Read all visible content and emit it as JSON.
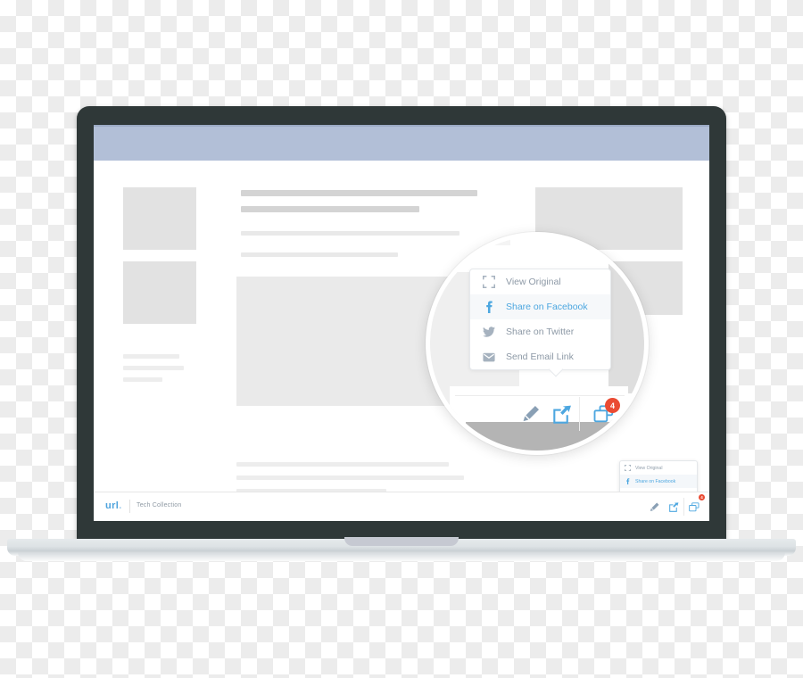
{
  "scene": {
    "device": "laptop",
    "background": "transparency-checkerboard"
  },
  "colors": {
    "bezel": "#2f3838",
    "header_bar": "#b2bfd7",
    "accent_blue": "#4da7e0",
    "muted_text": "#8d99a6",
    "badge_red": "#ea4b33",
    "placeholder_gray": "#e2e2e2",
    "page_white": "#ffffff"
  },
  "statusbar": {
    "logo": "url",
    "logo_dot": ".",
    "collection_name": "Tech Collection",
    "tools": [
      {
        "name": "edit-pencil-icon",
        "label": "Edit"
      },
      {
        "name": "share-icon",
        "label": "Share"
      },
      {
        "name": "collection-icon",
        "label": "Collection",
        "badge": "4"
      }
    ]
  },
  "share_menu": {
    "items": [
      {
        "icon": "expand-icon",
        "label": "View Original",
        "active": false
      },
      {
        "icon": "facebook-icon",
        "label": "Share on Facebook",
        "active": true
      },
      {
        "icon": "twitter-icon",
        "label": "Share on Twitter",
        "active": false
      },
      {
        "icon": "envelope-icon",
        "label": "Send Email Link",
        "active": false
      }
    ]
  },
  "magnifier": {
    "toolbar": [
      {
        "name": "edit-pencil-icon",
        "label": "Edit"
      },
      {
        "name": "share-icon",
        "label": "Share"
      },
      {
        "name": "collection-icon",
        "label": "Collection",
        "badge": "4"
      }
    ]
  }
}
